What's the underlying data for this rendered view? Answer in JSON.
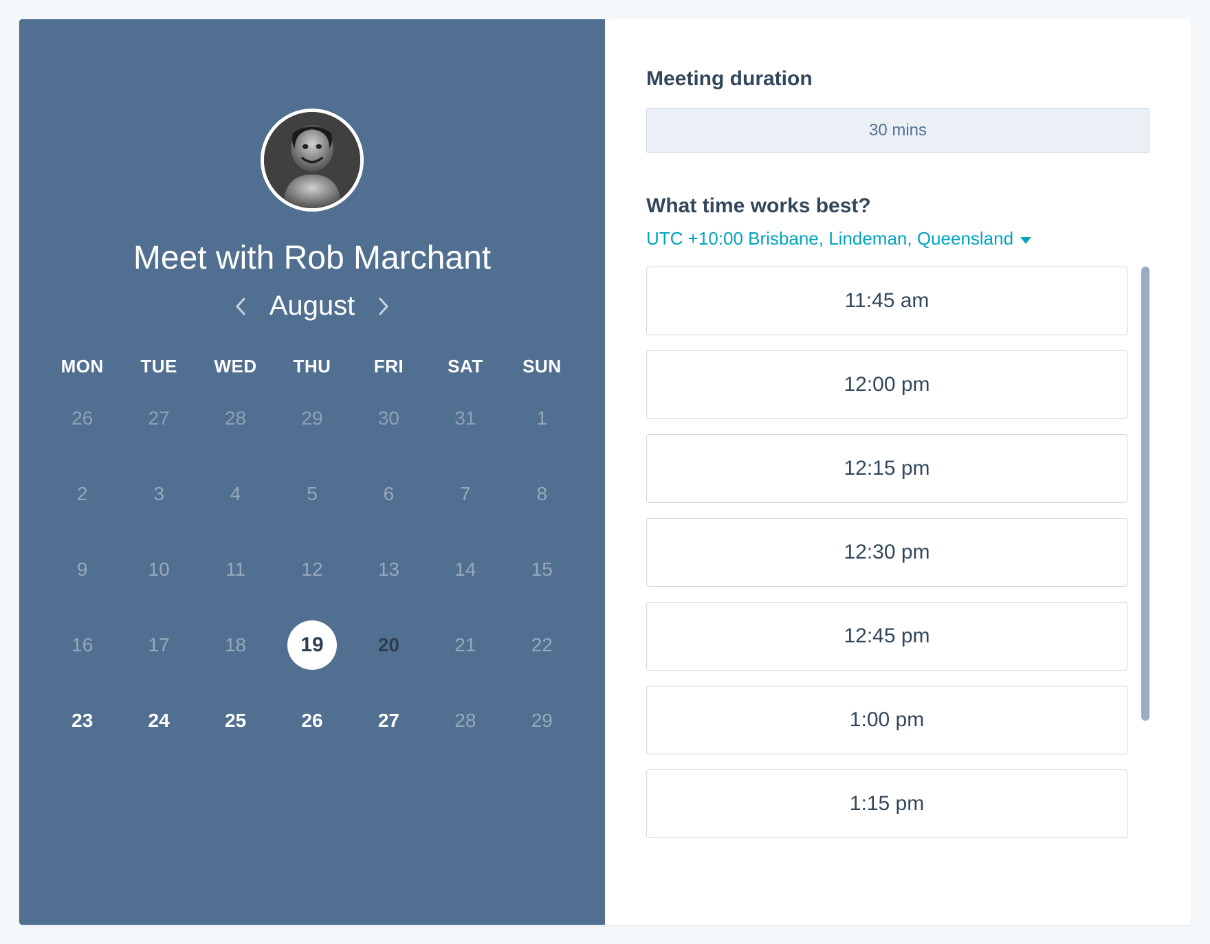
{
  "left": {
    "title": "Meet with Rob Marchant",
    "month": "August",
    "weekdays": [
      "MON",
      "TUE",
      "WED",
      "THU",
      "FRI",
      "SAT",
      "SUN"
    ],
    "days": [
      {
        "n": "26",
        "state": "out-month"
      },
      {
        "n": "27",
        "state": "out-month"
      },
      {
        "n": "28",
        "state": "out-month"
      },
      {
        "n": "29",
        "state": "out-month"
      },
      {
        "n": "30",
        "state": "out-month"
      },
      {
        "n": "31",
        "state": "out-month"
      },
      {
        "n": "1",
        "state": "in-month"
      },
      {
        "n": "2",
        "state": "in-month"
      },
      {
        "n": "3",
        "state": "in-month"
      },
      {
        "n": "4",
        "state": "in-month"
      },
      {
        "n": "5",
        "state": "in-month"
      },
      {
        "n": "6",
        "state": "in-month"
      },
      {
        "n": "7",
        "state": "in-month"
      },
      {
        "n": "8",
        "state": "in-month"
      },
      {
        "n": "9",
        "state": "in-month"
      },
      {
        "n": "10",
        "state": "in-month"
      },
      {
        "n": "11",
        "state": "in-month"
      },
      {
        "n": "12",
        "state": "in-month"
      },
      {
        "n": "13",
        "state": "in-month"
      },
      {
        "n": "14",
        "state": "in-month"
      },
      {
        "n": "15",
        "state": "in-month"
      },
      {
        "n": "16",
        "state": "in-month"
      },
      {
        "n": "17",
        "state": "in-month"
      },
      {
        "n": "18",
        "state": "in-month"
      },
      {
        "n": "19",
        "state": "selected"
      },
      {
        "n": "20",
        "state": "available-dark"
      },
      {
        "n": "21",
        "state": "in-month"
      },
      {
        "n": "22",
        "state": "in-month"
      },
      {
        "n": "23",
        "state": "available"
      },
      {
        "n": "24",
        "state": "available"
      },
      {
        "n": "25",
        "state": "available"
      },
      {
        "n": "26",
        "state": "available"
      },
      {
        "n": "27",
        "state": "available"
      },
      {
        "n": "28",
        "state": "in-month"
      },
      {
        "n": "29",
        "state": "in-month"
      }
    ]
  },
  "right": {
    "duration_title": "Meeting duration",
    "duration_value": "30 mins",
    "time_title": "What time works best?",
    "timezone": "UTC +10:00 Brisbane, Lindeman, Queensland",
    "slots": [
      "11:45 am",
      "12:00 pm",
      "12:15 pm",
      "12:30 pm",
      "12:45 pm",
      "1:00 pm",
      "1:15 pm"
    ]
  }
}
